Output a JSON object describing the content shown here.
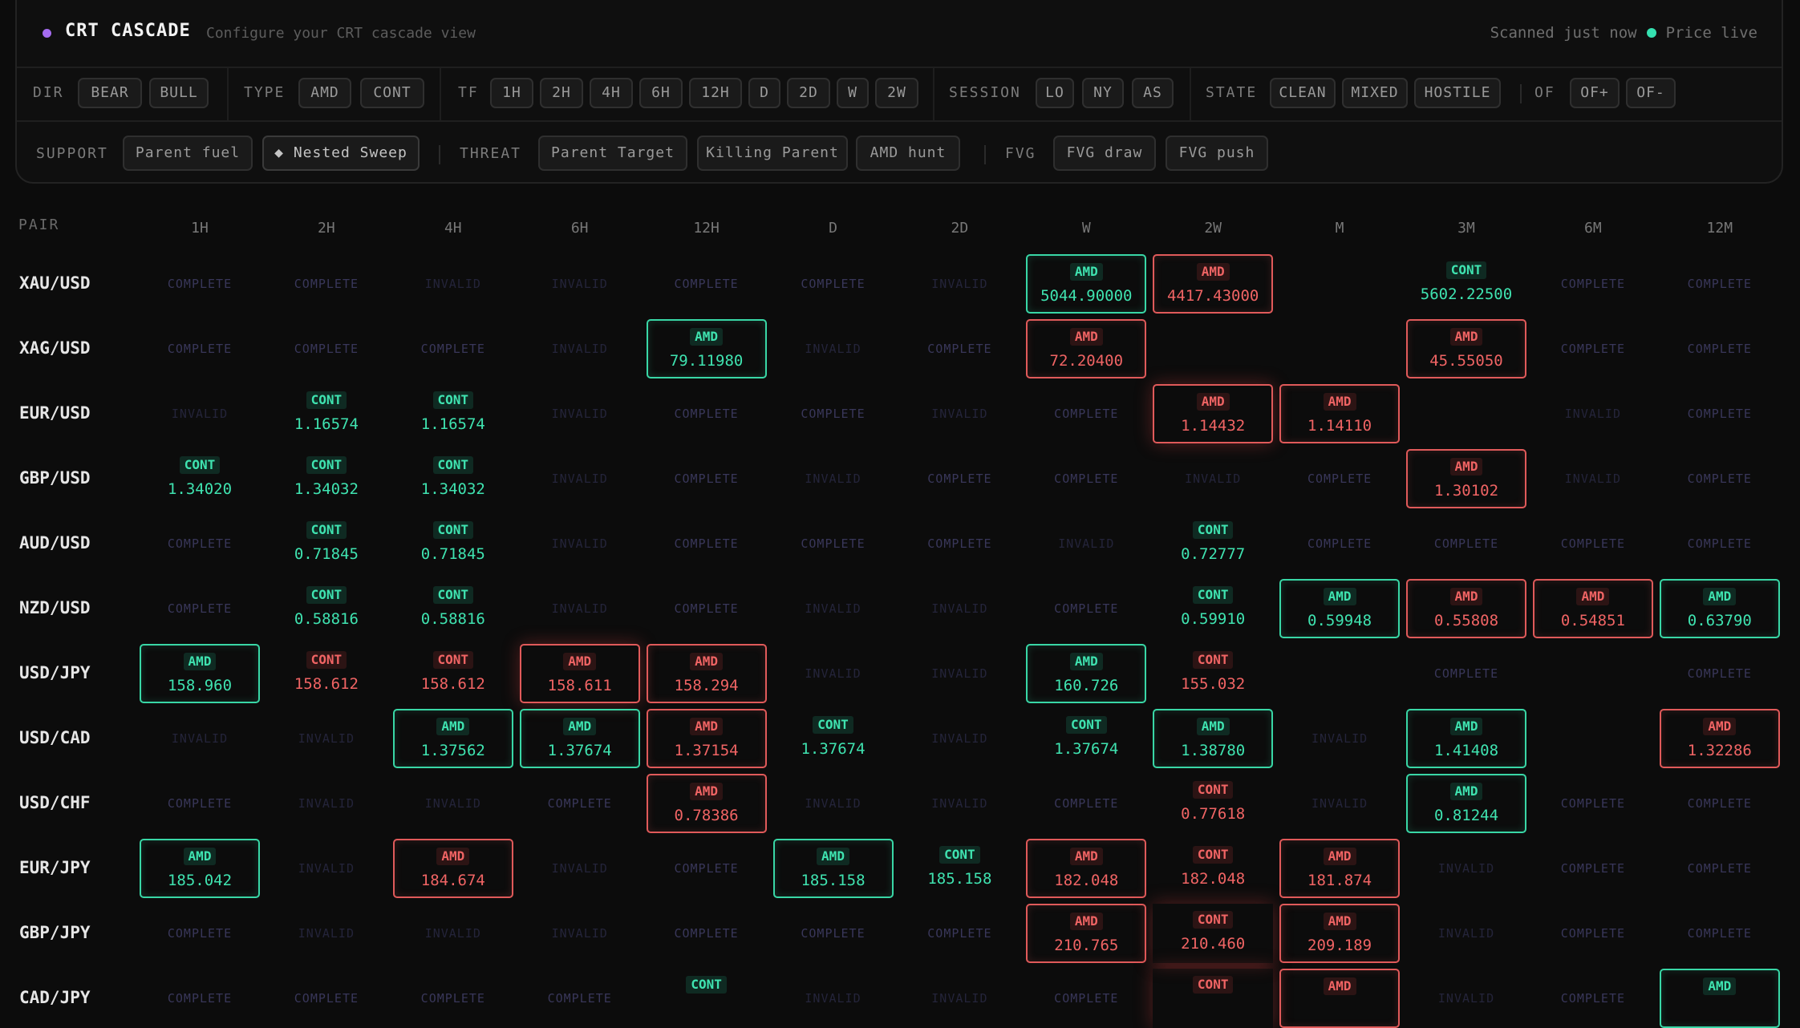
{
  "header": {
    "title": "CRT CASCADE",
    "subtitle": "Configure your CRT cascade view",
    "scan_status": "Scanned just now",
    "price_status": "Price live",
    "accent_color": "#a56cf0",
    "live_color": "#35e0b0"
  },
  "filters": {
    "row1": {
      "dir_label": "DIR",
      "dir_options": [
        "BEAR",
        "BULL"
      ],
      "type_label": "TYPE",
      "type_options": [
        "AMD",
        "CONT"
      ],
      "tf_label": "TF",
      "tf_options": [
        "1H",
        "2H",
        "4H",
        "6H",
        "12H",
        "D",
        "2D",
        "W",
        "2W"
      ],
      "session_label": "SESSION",
      "session_options": [
        "LO",
        "NY",
        "AS"
      ],
      "state_label": "STATE",
      "state_options": [
        "CLEAN",
        "MIXED",
        "HOSTILE"
      ],
      "of_label": "OF",
      "of_options": [
        "OF+",
        "OF-"
      ]
    },
    "row2": {
      "support_label": "SUPPORT",
      "support_options": [
        "Parent fuel",
        "◆ Nested Sweep"
      ],
      "threat_label": "THREAT",
      "threat_options": [
        "Parent Target",
        "Killing Parent",
        "AMD hunt"
      ],
      "fvg_label": "FVG",
      "fvg_options": [
        "FVG draw",
        "FVG push"
      ]
    }
  },
  "grid": {
    "pair_header": "PAIR",
    "columns": [
      "1H",
      "2H",
      "4H",
      "6H",
      "12H",
      "D",
      "2D",
      "W",
      "2W",
      "M",
      "3M",
      "6M",
      "12M"
    ],
    "rows": [
      {
        "pair": "XAU/USD",
        "cells": [
          {
            "s": "COMPLETE"
          },
          {
            "s": "COMPLETE"
          },
          {
            "s": "INVALID"
          },
          {
            "s": "INVALID"
          },
          {
            "s": "COMPLETE"
          },
          {
            "s": "COMPLETE"
          },
          {
            "s": "INVALID"
          },
          {
            "t": "AMD",
            "p": "5044.90000",
            "d": "bull",
            "b": 1
          },
          {
            "t": "AMD",
            "p": "4417.43000",
            "d": "bear",
            "b": 1
          },
          {},
          {
            "t": "CONT",
            "p": "5602.22500",
            "d": "bull"
          },
          {
            "s": "COMPLETE"
          },
          {
            "s": "COMPLETE"
          }
        ]
      },
      {
        "pair": "XAG/USD",
        "cells": [
          {
            "s": "COMPLETE"
          },
          {
            "s": "COMPLETE"
          },
          {
            "s": "COMPLETE"
          },
          {
            "s": "INVALID"
          },
          {
            "t": "AMD",
            "p": "79.11980",
            "d": "bull",
            "b": 1
          },
          {
            "s": "INVALID"
          },
          {
            "s": "COMPLETE"
          },
          {
            "t": "AMD",
            "p": "72.20400",
            "d": "bear",
            "b": 1
          },
          {},
          {},
          {
            "t": "AMD",
            "p": "45.55050",
            "d": "bear",
            "b": 1
          },
          {
            "s": "COMPLETE"
          },
          {
            "s": "COMPLETE"
          }
        ]
      },
      {
        "pair": "EUR/USD",
        "cells": [
          {
            "s": "INVALID"
          },
          {
            "t": "CONT",
            "p": "1.16574",
            "d": "bull"
          },
          {
            "t": "CONT",
            "p": "1.16574",
            "d": "bull"
          },
          {
            "s": "INVALID"
          },
          {
            "s": "COMPLETE"
          },
          {
            "s": "COMPLETE"
          },
          {
            "s": "INVALID"
          },
          {
            "s": "COMPLETE"
          },
          {
            "t": "AMD",
            "p": "1.14432",
            "d": "bear",
            "b": 1,
            "g": 1
          },
          {
            "t": "AMD",
            "p": "1.14110",
            "d": "bear",
            "b": 1
          },
          {},
          {
            "s": "INVALID"
          },
          {
            "s": "COMPLETE"
          }
        ]
      },
      {
        "pair": "GBP/USD",
        "cells": [
          {
            "t": "CONT",
            "p": "1.34020",
            "d": "bull"
          },
          {
            "t": "CONT",
            "p": "1.34032",
            "d": "bull"
          },
          {
            "t": "CONT",
            "p": "1.34032",
            "d": "bull"
          },
          {
            "s": "INVALID"
          },
          {
            "s": "COMPLETE"
          },
          {
            "s": "INVALID"
          },
          {
            "s": "COMPLETE"
          },
          {
            "s": "COMPLETE"
          },
          {
            "s": "INVALID"
          },
          {
            "s": "COMPLETE"
          },
          {
            "t": "AMD",
            "p": "1.30102",
            "d": "bear",
            "b": 1
          },
          {
            "s": "INVALID"
          },
          {
            "s": "COMPLETE"
          }
        ]
      },
      {
        "pair": "AUD/USD",
        "cells": [
          {
            "s": "COMPLETE"
          },
          {
            "t": "CONT",
            "p": "0.71845",
            "d": "bull"
          },
          {
            "t": "CONT",
            "p": "0.71845",
            "d": "bull"
          },
          {
            "s": "INVALID"
          },
          {
            "s": "COMPLETE"
          },
          {
            "s": "COMPLETE"
          },
          {
            "s": "COMPLETE"
          },
          {
            "s": "INVALID"
          },
          {
            "t": "CONT",
            "p": "0.72777",
            "d": "bull"
          },
          {
            "s": "COMPLETE"
          },
          {
            "s": "COMPLETE"
          },
          {
            "s": "COMPLETE"
          },
          {
            "s": "COMPLETE"
          }
        ]
      },
      {
        "pair": "NZD/USD",
        "cells": [
          {
            "s": "COMPLETE"
          },
          {
            "t": "CONT",
            "p": "0.58816",
            "d": "bull"
          },
          {
            "t": "CONT",
            "p": "0.58816",
            "d": "bull"
          },
          {
            "s": "INVALID"
          },
          {
            "s": "COMPLETE"
          },
          {
            "s": "INVALID"
          },
          {
            "s": "INVALID"
          },
          {
            "s": "COMPLETE"
          },
          {
            "t": "CONT",
            "p": "0.59910",
            "d": "bull"
          },
          {
            "t": "AMD",
            "p": "0.59948",
            "d": "bull",
            "b": 1
          },
          {
            "t": "AMD",
            "p": "0.55808",
            "d": "bear",
            "b": 1
          },
          {
            "t": "AMD",
            "p": "0.54851",
            "d": "bear",
            "b": 1
          },
          {
            "t": "AMD",
            "p": "0.63790",
            "d": "bull",
            "b": 1
          }
        ]
      },
      {
        "pair": "USD/JPY",
        "cells": [
          {
            "t": "AMD",
            "p": "158.960",
            "d": "bull",
            "b": 1
          },
          {
            "t": "CONT",
            "p": "158.612",
            "d": "bear"
          },
          {
            "t": "CONT",
            "p": "158.612",
            "d": "bear"
          },
          {
            "t": "AMD",
            "p": "158.611",
            "d": "bear",
            "b": 1,
            "g": 1
          },
          {
            "t": "AMD",
            "p": "158.294",
            "d": "bear",
            "b": 1
          },
          {
            "s": "INVALID"
          },
          {
            "s": "INVALID"
          },
          {
            "t": "AMD",
            "p": "160.726",
            "d": "bull",
            "b": 1
          },
          {
            "t": "CONT",
            "p": "155.032",
            "d": "bear"
          },
          {},
          {
            "s": "COMPLETE"
          },
          {},
          {
            "s": "COMPLETE"
          }
        ]
      },
      {
        "pair": "USD/CAD",
        "cells": [
          {
            "s": "INVALID"
          },
          {
            "s": "INVALID"
          },
          {
            "t": "AMD",
            "p": "1.37562",
            "d": "bull",
            "b": 1
          },
          {
            "t": "AMD",
            "p": "1.37674",
            "d": "bull",
            "b": 1
          },
          {
            "t": "AMD",
            "p": "1.37154",
            "d": "bear",
            "b": 1
          },
          {
            "t": "CONT",
            "p": "1.37674",
            "d": "bull"
          },
          {
            "s": "INVALID"
          },
          {
            "t": "CONT",
            "p": "1.37674",
            "d": "bull"
          },
          {
            "t": "AMD",
            "p": "1.38780",
            "d": "bull",
            "b": 1
          },
          {
            "s": "INVALID"
          },
          {
            "t": "AMD",
            "p": "1.41408",
            "d": "bull",
            "b": 1
          },
          {},
          {
            "t": "AMD",
            "p": "1.32286",
            "d": "bear",
            "b": 1
          }
        ]
      },
      {
        "pair": "USD/CHF",
        "cells": [
          {
            "s": "COMPLETE"
          },
          {
            "s": "INVALID"
          },
          {
            "s": "INVALID"
          },
          {
            "s": "COMPLETE"
          },
          {
            "t": "AMD",
            "p": "0.78386",
            "d": "bear",
            "b": 1
          },
          {
            "s": "INVALID"
          },
          {
            "s": "INVALID"
          },
          {
            "s": "COMPLETE"
          },
          {
            "t": "CONT",
            "p": "0.77618",
            "d": "bear"
          },
          {
            "s": "INVALID"
          },
          {
            "t": "AMD",
            "p": "0.81244",
            "d": "bull",
            "b": 1
          },
          {
            "s": "COMPLETE"
          },
          {
            "s": "COMPLETE"
          }
        ]
      },
      {
        "pair": "EUR/JPY",
        "cells": [
          {
            "t": "AMD",
            "p": "185.042",
            "d": "bull",
            "b": 1
          },
          {
            "s": "INVALID"
          },
          {
            "t": "AMD",
            "p": "184.674",
            "d": "bear",
            "b": 1
          },
          {
            "s": "INVALID"
          },
          {
            "s": "COMPLETE"
          },
          {
            "t": "AMD",
            "p": "185.158",
            "d": "bull",
            "b": 1
          },
          {
            "t": "CONT",
            "p": "185.158",
            "d": "bull"
          },
          {
            "t": "AMD",
            "p": "182.048",
            "d": "bear",
            "b": 1
          },
          {
            "t": "CONT",
            "p": "182.048",
            "d": "bear"
          },
          {
            "t": "AMD",
            "p": "181.874",
            "d": "bear",
            "b": 1
          },
          {
            "s": "INVALID"
          },
          {
            "s": "COMPLETE"
          },
          {
            "s": "COMPLETE"
          }
        ]
      },
      {
        "pair": "GBP/JPY",
        "cells": [
          {
            "s": "COMPLETE"
          },
          {
            "s": "INVALID"
          },
          {
            "s": "INVALID"
          },
          {
            "s": "INVALID"
          },
          {
            "s": "COMPLETE"
          },
          {
            "s": "COMPLETE"
          },
          {
            "s": "COMPLETE"
          },
          {
            "t": "AMD",
            "p": "210.765",
            "d": "bear",
            "b": 1
          },
          {
            "t": "CONT",
            "p": "210.460",
            "d": "bear",
            "g": 1
          },
          {
            "t": "AMD",
            "p": "209.189",
            "d": "bear",
            "b": 1
          },
          {
            "s": "INVALID"
          },
          {
            "s": "COMPLETE"
          },
          {
            "s": "COMPLETE"
          }
        ]
      },
      {
        "pair": "CAD/JPY",
        "cells": [
          {
            "s": "COMPLETE"
          },
          {
            "s": "COMPLETE"
          },
          {
            "s": "COMPLETE"
          },
          {
            "s": "COMPLETE"
          },
          {
            "t": "CONT",
            "p": "",
            "d": "bull"
          },
          {
            "s": "INVALID"
          },
          {
            "s": "INVALID"
          },
          {
            "s": "COMPLETE"
          },
          {
            "t": "CONT",
            "p": "",
            "d": "bear",
            "g": 1
          },
          {
            "t": "AMD",
            "p": "",
            "d": "bear",
            "b": 1
          },
          {
            "s": "INVALID"
          },
          {
            "s": "COMPLETE"
          },
          {
            "t": "AMD",
            "p": "",
            "d": "bull",
            "b": 1
          }
        ]
      }
    ]
  }
}
